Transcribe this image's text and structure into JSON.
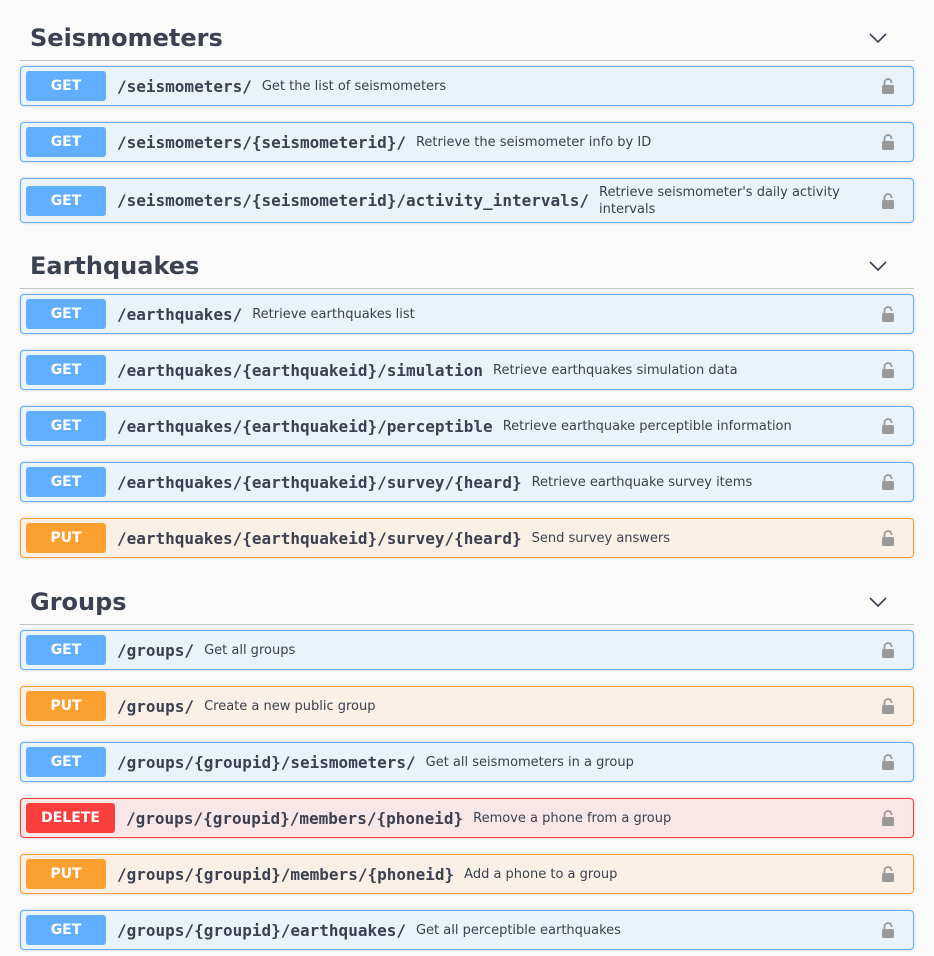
{
  "colors": {
    "get": "#61affe",
    "put": "#fca130",
    "delete": "#f93e3e",
    "text": "#3b4151",
    "background": "#fafafa"
  },
  "icons": {
    "toggle": "chevron-down-icon",
    "lock": "lock-icon"
  },
  "sections": [
    {
      "title": "Seismometers",
      "operations": [
        {
          "method": "GET",
          "path": "/seismometers/",
          "summary": "Get the list of seismometers"
        },
        {
          "method": "GET",
          "path": "/seismometers/{seismometerid}/",
          "summary": "Retrieve the seismometer info by ID"
        },
        {
          "method": "GET",
          "path": "/seismometers/{seismometerid}/activity_intervals/",
          "summary": "Retrieve seismometer's daily activity intervals"
        }
      ]
    },
    {
      "title": "Earthquakes",
      "operations": [
        {
          "method": "GET",
          "path": "/earthquakes/",
          "summary": "Retrieve earthquakes list"
        },
        {
          "method": "GET",
          "path": "/earthquakes/{earthquakeid}/simulation",
          "summary": "Retrieve earthquakes simulation data"
        },
        {
          "method": "GET",
          "path": "/earthquakes/{earthquakeid}/perceptible",
          "summary": "Retrieve earthquake perceptible information"
        },
        {
          "method": "GET",
          "path": "/earthquakes/{earthquakeid}/survey/{heard}",
          "summary": "Retrieve earthquake survey items"
        },
        {
          "method": "PUT",
          "path": "/earthquakes/{earthquakeid}/survey/{heard}",
          "summary": "Send survey answers"
        }
      ]
    },
    {
      "title": "Groups",
      "operations": [
        {
          "method": "GET",
          "path": "/groups/",
          "summary": "Get all groups"
        },
        {
          "method": "PUT",
          "path": "/groups/",
          "summary": "Create a new public group"
        },
        {
          "method": "GET",
          "path": "/groups/{groupid}/seismometers/",
          "summary": "Get all seismometers in a group"
        },
        {
          "method": "DELETE",
          "path": "/groups/{groupid}/members/{phoneid}",
          "summary": "Remove a phone from a group"
        },
        {
          "method": "PUT",
          "path": "/groups/{groupid}/members/{phoneid}",
          "summary": "Add a phone to a group"
        },
        {
          "method": "GET",
          "path": "/groups/{groupid}/earthquakes/",
          "summary": "Get all perceptible earthquakes"
        }
      ]
    }
  ]
}
